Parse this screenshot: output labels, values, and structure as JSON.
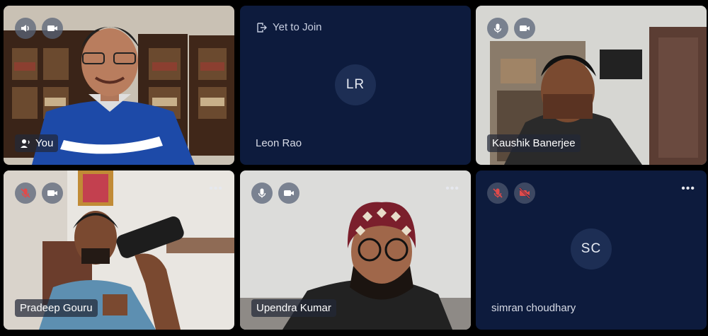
{
  "participants": [
    {
      "name": "You"
    },
    {
      "name": "Leon Rao",
      "initials": "LR",
      "status": "Yet to Join"
    },
    {
      "name": "Kaushik Banerjee"
    },
    {
      "name": "Pradeep Gouru"
    },
    {
      "name": "Upendra Kumar"
    },
    {
      "name": "simran choudhary",
      "initials": "SC"
    }
  ],
  "tile_menu": "•••",
  "colors": {
    "tile_dark": "#0d1b3d",
    "avatar_bg": "#1d2e54",
    "muted_red": "#e14b4b"
  }
}
